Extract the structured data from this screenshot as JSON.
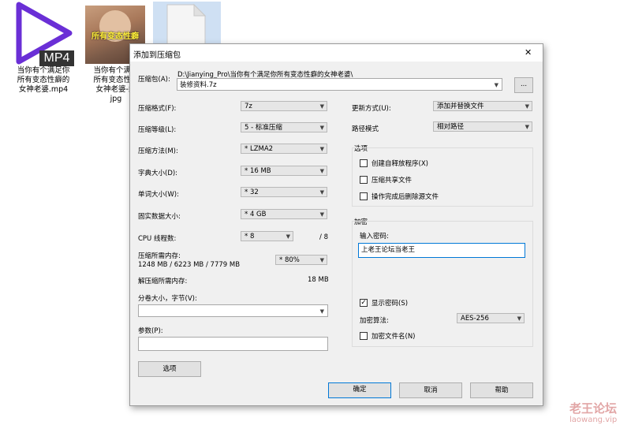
{
  "desktop": {
    "icons": [
      {
        "badge": "MP4",
        "label_lines": [
          "当你有个满足你",
          "所有变态性癖的",
          "女神老婆.mp4"
        ]
      },
      {
        "thumb_text": "所有变态性癖",
        "label_lines": [
          "当你有个满足",
          "所有变态性癖",
          "女神老婆-封",
          "jpg"
        ]
      }
    ]
  },
  "dialog": {
    "title": "添加到压缩包",
    "close_glyph": "✕",
    "archive_label": "压缩包(A):",
    "archive_path": "D:\\Jianying_Pro\\当你有个满足你所有变态性癖的女神老婆\\",
    "archive_name": "装修资料.7z",
    "browse_label": "...",
    "left": {
      "format_label": "压缩格式(F):",
      "format_value": "7z",
      "level_label": "压缩等级(L):",
      "level_value": "5 - 标准压缩",
      "method_label": "压缩方法(M):",
      "method_value": "* LZMA2",
      "dict_label": "字典大小(D):",
      "dict_value": "* 16 MB",
      "word_label": "单词大小(W):",
      "word_value": "* 32",
      "solid_label": "固实数据大小:",
      "solid_value": "* 4 GB",
      "cpu_label": "CPU 线程数:",
      "cpu_value": "* 8",
      "cpu_total": "/ 8",
      "mem_label": "压缩所需内存:",
      "mem_values": "1248 MB / 6223 MB / 7779 MB",
      "mem_percent": "* 80%",
      "decomp_label": "解压缩所需内存:",
      "decomp_value": "18 MB",
      "split_label": "分卷大小，字节(V):",
      "split_value": "",
      "params_label": "参数(P):",
      "params_value": "",
      "options_button": "选项"
    },
    "right": {
      "update_label": "更新方式(U):",
      "update_value": "添加并替换文件",
      "pathmode_label": "路径模式",
      "pathmode_value": "相对路径",
      "options_group": "选项",
      "opt_sfx": "创建自释放程序(X)",
      "opt_shared": "压缩共享文件",
      "opt_delete": "操作完成后删除源文件",
      "encrypt_group": "加密",
      "password_label": "输入密码:",
      "password_value": "上老王论坛当老王",
      "show_password": "显示密码(S)",
      "show_password_checked": "✓",
      "enc_method_label": "加密算法:",
      "enc_method_value": "AES-256",
      "enc_names": "加密文件名(N)"
    },
    "buttons": {
      "ok": "确定",
      "cancel": "取消",
      "help": "帮助"
    }
  },
  "watermark": {
    "title": "老王论坛",
    "url": "laowang.vip"
  },
  "colors": {
    "mp4_play": "#6a2fd6",
    "accent_border": "#0078d7"
  }
}
